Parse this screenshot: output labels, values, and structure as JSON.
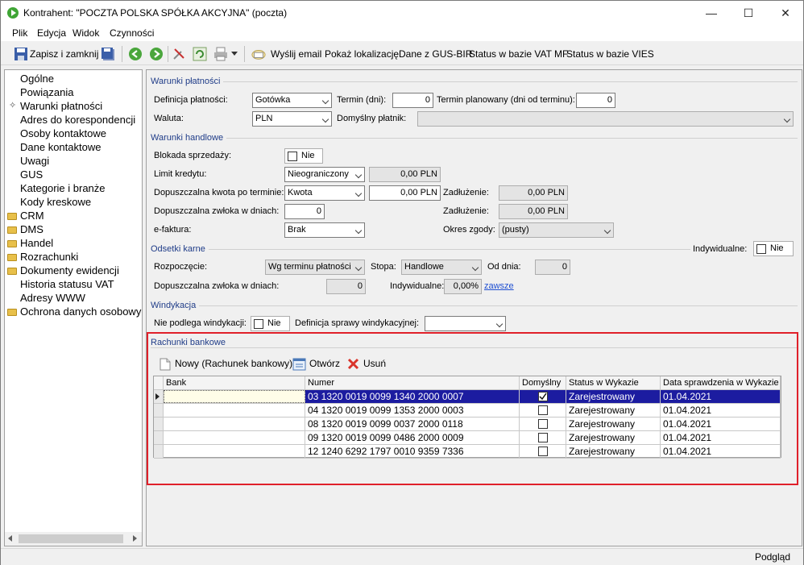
{
  "window": {
    "title": "Kontrahent: \"POCZTA POLSKA SPÓŁKA AKCYJNA\" (poczta)",
    "minimize": "—",
    "maximize": "☐",
    "close": "✕"
  },
  "menu": [
    "Plik",
    "Edycja",
    "Widok",
    "Czynności"
  ],
  "toolbar": {
    "save_close": "Zapisz i zamknij",
    "send_email": "Wyślij email",
    "show_location": "Pokaż lokalizację",
    "gus_data": "Dane z GUS-BIR",
    "vat_status": "Status w bazie VAT MF",
    "vies_status": "Status w bazie VIES"
  },
  "nav": {
    "items": [
      {
        "label": "Ogólne",
        "folder": false
      },
      {
        "label": "Powiązania",
        "folder": false
      },
      {
        "label": "Warunki płatności",
        "folder": false,
        "active": true
      },
      {
        "label": "Adres do korespondencji",
        "folder": false
      },
      {
        "label": "Osoby kontaktowe",
        "folder": false
      },
      {
        "label": "Dane kontaktowe",
        "folder": false
      },
      {
        "label": "Uwagi",
        "folder": false
      },
      {
        "label": "GUS",
        "folder": false
      },
      {
        "label": "Kategorie i branże",
        "folder": false
      },
      {
        "label": "Kody kreskowe",
        "folder": false
      },
      {
        "label": "CRM",
        "folder": true
      },
      {
        "label": "DMS",
        "folder": true
      },
      {
        "label": "Handel",
        "folder": true
      },
      {
        "label": "Rozrachunki",
        "folder": true
      },
      {
        "label": "Dokumenty ewidencji",
        "folder": true
      },
      {
        "label": "Historia statusu VAT",
        "folder": false
      },
      {
        "label": "Adresy WWW",
        "folder": false
      },
      {
        "label": "Ochrona danych osobowych",
        "folder": true
      }
    ]
  },
  "payment": {
    "section": "Warunki płatności",
    "def_label": "Definicja płatności:",
    "def_value": "Gotówka",
    "term_label": "Termin (dni):",
    "term_value": "0",
    "planned_label": "Termin planowany (dni od terminu):",
    "planned_value": "0",
    "currency_label": "Waluta:",
    "currency_value": "PLN",
    "payer_label": "Domyślny płatnik:",
    "payer_value": ""
  },
  "trade": {
    "section": "Warunki handlowe",
    "block_label": "Blokada  sprzedaży:",
    "block_value": "Nie",
    "limit_label": "Limit kredytu:",
    "limit_type": "Nieograniczony",
    "limit_amount": "0,00 PLN",
    "overdue_label": "Dopuszczalna kwota po terminie:",
    "overdue_type": "Kwota",
    "overdue_amount": "0,00 PLN",
    "debt_label_1": "Zadłużenie:",
    "debt_value_1": "0,00 PLN",
    "delay_label": "Dopuszczalna zwłoka w dniach:",
    "delay_value": "0",
    "debt_label_2": "Zadłużenie:",
    "debt_value_2": "0,00 PLN",
    "efaktura_label": "e-faktura:",
    "efaktura_value": "Brak",
    "consent_label": "Okres zgody:",
    "consent_value": "(pusty)"
  },
  "interest": {
    "section": "Odsetki karne",
    "individual_label": "Indywidualne:",
    "individual_value": "Nie",
    "start_label": "Rozpoczęcie:",
    "start_value": "Wg terminu płatności",
    "rate_label": "Stopa:",
    "rate_value": "Handlowe",
    "from_day_label": "Od dnia:",
    "from_day_value": "0",
    "delay_label": "Dopuszczalna zwłoka w dniach:",
    "delay_value": "0",
    "ind_rate_label": "Indywidualne:",
    "ind_rate_value": "0,00%",
    "always_link": "zawsze"
  },
  "collection": {
    "section": "Windykacja",
    "exempt_label": "Nie podlega windykacji:",
    "exempt_value": "Nie",
    "def_label": "Definicja sprawy windykacyjnej:",
    "def_value": ""
  },
  "bank": {
    "section": "Rachunki bankowe",
    "new_button": "Nowy (Rachunek bankowy)",
    "open_button": "Otwórz",
    "delete_button": "Usuń",
    "columns": [
      "Bank",
      "Numer",
      "Domyślny",
      "Status w Wykazie",
      "Data sprawdzenia w Wykazie"
    ],
    "rows": [
      {
        "bank": "",
        "number": "03 1320 0019 0099 1340 2000 0007",
        "default": true,
        "status": "Zarejestrowany",
        "date": "01.04.2021"
      },
      {
        "bank": "",
        "number": "04 1320 0019 0099 1353 2000 0003",
        "default": false,
        "status": "Zarejestrowany",
        "date": "01.04.2021"
      },
      {
        "bank": "",
        "number": "08 1320 0019 0099 0037 2000 0118",
        "default": false,
        "status": "Zarejestrowany",
        "date": "01.04.2021"
      },
      {
        "bank": "",
        "number": "09 1320 0019 0099 0486 2000 0009",
        "default": false,
        "status": "Zarejestrowany",
        "date": "01.04.2021"
      },
      {
        "bank": "",
        "number": "12 1240 6292 1797 0010 9359 7336",
        "default": false,
        "status": "Zarejestrowany",
        "date": "01.04.2021"
      }
    ]
  },
  "status": {
    "preview": "Podgląd"
  }
}
